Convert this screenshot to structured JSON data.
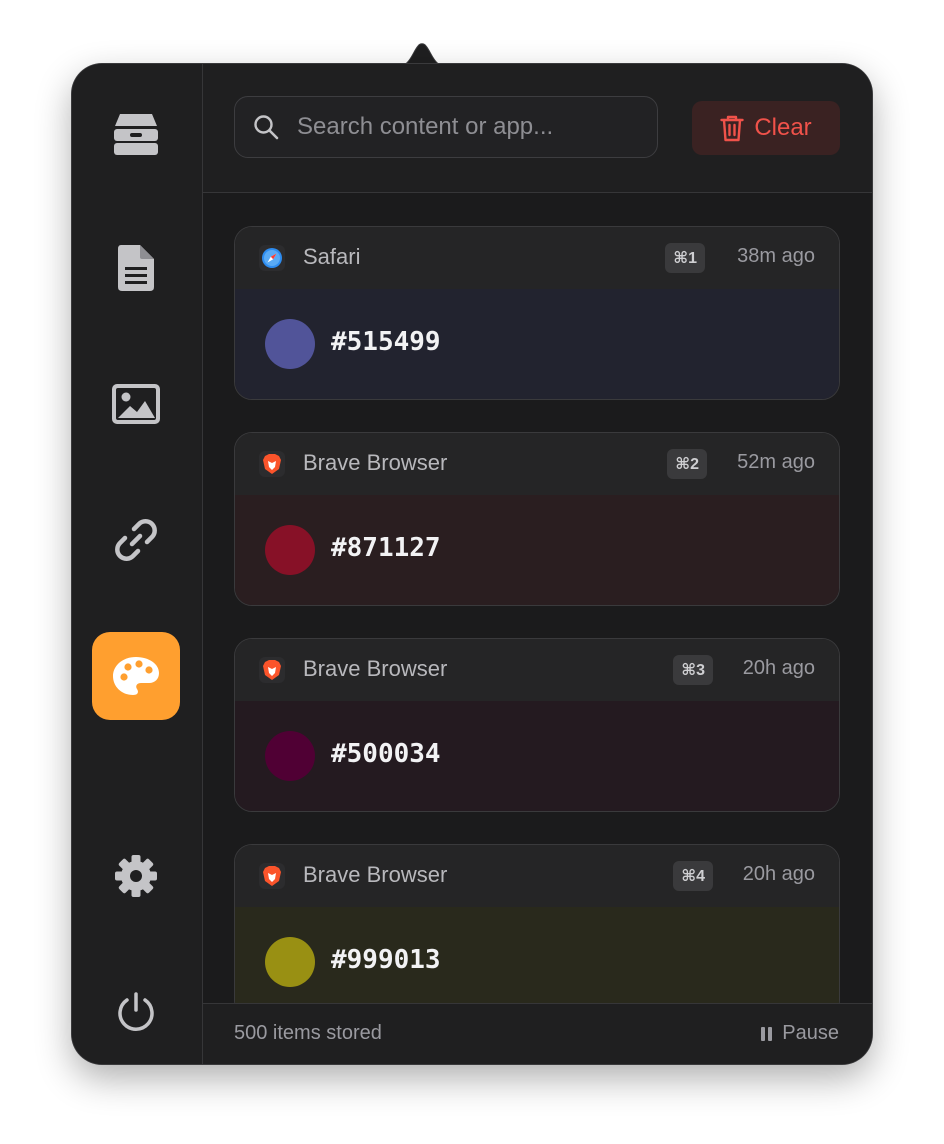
{
  "search": {
    "placeholder": "Search content or app..."
  },
  "toolbar": {
    "clear_label": "Clear"
  },
  "sidebar": {
    "items": [
      {
        "name": "archive",
        "icon": "tray-icon",
        "active": false
      },
      {
        "name": "text",
        "icon": "document-icon",
        "active": false
      },
      {
        "name": "images",
        "icon": "image-icon",
        "active": false
      },
      {
        "name": "links",
        "icon": "link-icon",
        "active": false
      },
      {
        "name": "colors",
        "icon": "palette-icon",
        "active": true
      },
      {
        "name": "settings",
        "icon": "gear-icon",
        "active": false
      },
      {
        "name": "quit",
        "icon": "power-icon",
        "active": false
      }
    ],
    "active_color": "#ff9f2f"
  },
  "items": [
    {
      "app": "Safari",
      "shortcut": "⌘1",
      "time": "38m ago",
      "color": "#515499",
      "hex": "#515499",
      "tint": "#22232f"
    },
    {
      "app": "Brave Browser",
      "shortcut": "⌘2",
      "time": "52m ago",
      "color": "#871127",
      "hex": "#871127",
      "tint": "#2a1e20"
    },
    {
      "app": "Brave Browser",
      "shortcut": "⌘3",
      "time": "20h ago",
      "color": "#500034",
      "hex": "#500034",
      "tint": "#241a20"
    },
    {
      "app": "Brave Browser",
      "shortcut": "⌘4",
      "time": "20h ago",
      "color": "#999013",
      "hex": "#999013",
      "tint": "#29291c"
    }
  ],
  "footer": {
    "count": "500 items stored",
    "pause_label": "Pause"
  },
  "colors": {
    "panel": "#1b1b1c",
    "clear_text": "#f0524a",
    "clear_bg": "#3a2222"
  }
}
